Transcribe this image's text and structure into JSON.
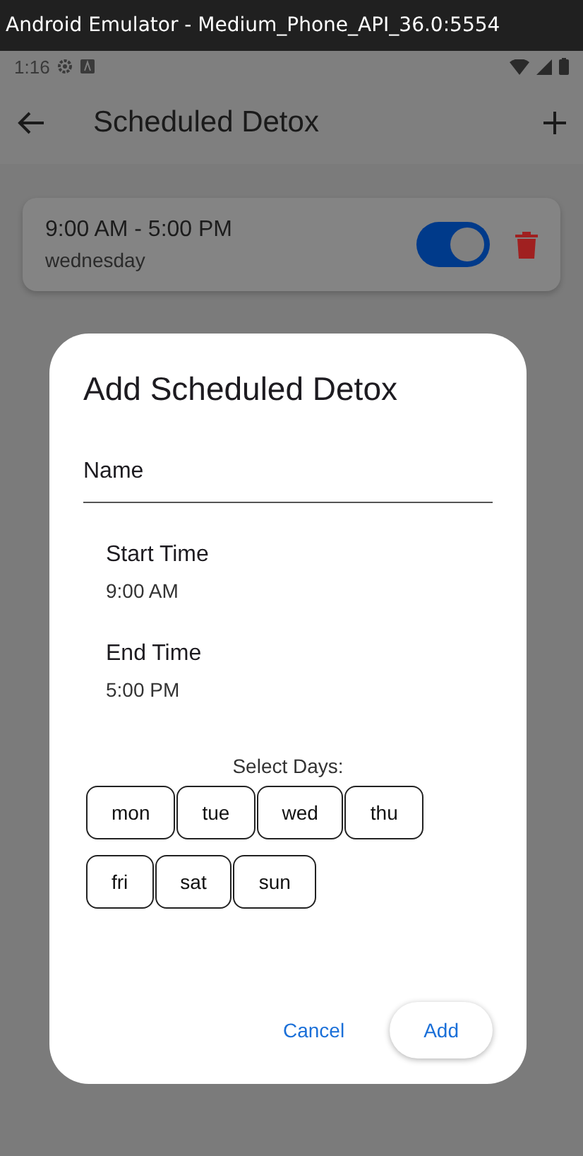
{
  "window": {
    "title": "Android Emulator - Medium_Phone_API_36.0:5554"
  },
  "status_bar": {
    "time": "1:16"
  },
  "app_bar": {
    "title": "Scheduled Detox"
  },
  "schedules": [
    {
      "time_range": "9:00 AM - 5:00 PM",
      "days": "wednesday",
      "on": true
    }
  ],
  "dialog": {
    "title": "Add Scheduled Detox",
    "name_field": {
      "placeholder": "Name"
    },
    "start": {
      "label": "Start Time",
      "value": "9:00 AM"
    },
    "end": {
      "label": "End Time",
      "value": "5:00 PM"
    },
    "days_label": "Select Days:",
    "days": [
      {
        "label": "mon",
        "selected": false
      },
      {
        "label": "tue",
        "selected": false
      },
      {
        "label": "wed",
        "selected": false
      },
      {
        "label": "thu",
        "selected": false
      },
      {
        "label": "fri",
        "selected": false
      },
      {
        "label": "sat",
        "selected": false
      },
      {
        "label": "sun",
        "selected": false
      }
    ],
    "buttons": [
      {
        "label": "Cancel",
        "kind": "text"
      },
      {
        "label": "Add",
        "kind": "elevated"
      }
    ]
  }
}
